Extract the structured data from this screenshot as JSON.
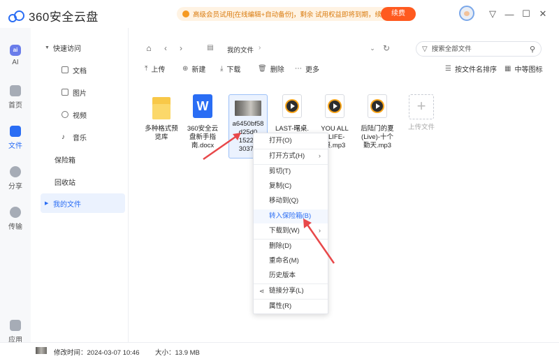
{
  "app": {
    "title": "360安全云盘",
    "promo_text": "高级会员试用[在线编辑+自动备份]，剩余 试用权益即将到期，续费继续使用",
    "renew_label": "续费"
  },
  "rail": [
    {
      "label": "AI",
      "icon": "ai-icon"
    },
    {
      "label": "首页",
      "icon": "home-icon"
    },
    {
      "label": "文件",
      "icon": "folder-icon"
    },
    {
      "label": "分享",
      "icon": "share-icon"
    },
    {
      "label": "传输",
      "icon": "transfer-icon"
    },
    {
      "label": "应用",
      "icon": "apps-icon"
    }
  ],
  "sidebar": {
    "quick_access": "快速访问",
    "items": [
      {
        "label": "文档",
        "icon": "doc-icon"
      },
      {
        "label": "图片",
        "icon": "image-icon"
      },
      {
        "label": "视频",
        "icon": "video-icon"
      },
      {
        "label": "音乐",
        "icon": "music-icon"
      }
    ],
    "vault": "保险箱",
    "recycle": "回收站",
    "my_files": "我的文件"
  },
  "nav": {
    "breadcrumb": "我的文件",
    "search_placeholder": "搜索全部文件"
  },
  "actions": {
    "upload": "上传",
    "new": "新建",
    "download": "下载",
    "delete": "删除",
    "more": "更多",
    "sort": "按文件名排序",
    "view": "中等图标"
  },
  "files": [
    {
      "name": "多种格式预览库",
      "type": "folder"
    },
    {
      "name": "360安全云盘新手指南.docx",
      "type": "word"
    },
    {
      "name": "a6450bf58d25d0…152213037e…",
      "type": "image"
    },
    {
      "name": "LAST-曙桌.mp3",
      "type": "audio"
    },
    {
      "name": "YOU ALL / LIFE-桌.mp3",
      "type": "audio"
    },
    {
      "name": "后陆门的夏(Live)-十个勤天.mp3",
      "type": "audio"
    },
    {
      "name": "上传文件",
      "type": "upload"
    }
  ],
  "file_labels": {
    "f1": [
      "多种格式预",
      "览库"
    ],
    "f2": [
      "360安全云",
      "盘新手指",
      "南.docx"
    ],
    "f3": [
      "a6450bf58",
      "d25d0",
      "15221",
      "3037e"
    ],
    "f4": [
      "LAST-曙桌."
    ],
    "f5": [
      "YOU ALL",
      "/ LIFE-",
      "桌.mp3"
    ],
    "f6": [
      "后陆门的夏",
      "(Live)-十个",
      "勤天.mp3"
    ],
    "f7": [
      "上传文件"
    ]
  },
  "context_menu": {
    "open": "打开(O)",
    "open_with": "打开方式(H)",
    "cut": "剪切(T)",
    "copy": "复制(C)",
    "move_to": "移动到(Q)",
    "to_vault": "转入保险箱(B)",
    "download_to": "下载到(W)",
    "delete": "删除(D)",
    "rename": "重命名(M)",
    "history": "历史版本",
    "share_link": "链接分享(L)",
    "properties": "属性(R)"
  },
  "status": {
    "modified": "修改时间：2024-03-07 10:46",
    "size": "大小：13.9 MB"
  },
  "colors": {
    "accent": "#2a6df4",
    "renew": "#ff5a1f",
    "arrow": "#e8484a"
  }
}
